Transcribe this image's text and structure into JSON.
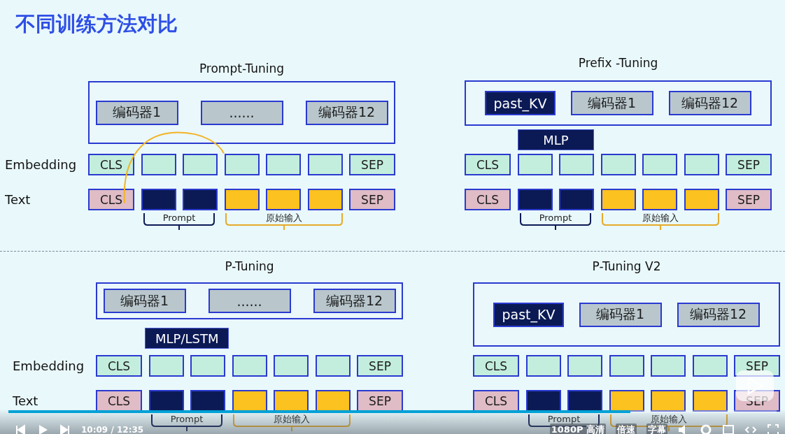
{
  "title": "不同训练方法对比",
  "panels": [
    {
      "title": "Prompt-Tuning",
      "encoders": [
        {
          "label": "编码器1",
          "kind": "layer"
        },
        {
          "label": "......",
          "kind": "layer"
        },
        {
          "label": "编码器12",
          "kind": "layer"
        }
      ],
      "link_curve": true,
      "rows": [
        {
          "label": "Embedding",
          "tokens": [
            {
              "label": "CLS",
              "kind": "embed"
            },
            {
              "kind": "embed"
            },
            {
              "kind": "embed"
            },
            {
              "kind": "embed"
            },
            {
              "kind": "embed"
            },
            {
              "kind": "embed"
            },
            {
              "label": "SEP",
              "kind": "embed"
            }
          ]
        },
        {
          "label": "Text",
          "tokens": [
            {
              "label": "CLS",
              "kind": "special"
            },
            {
              "kind": "prompt"
            },
            {
              "kind": "prompt"
            },
            {
              "kind": "input"
            },
            {
              "kind": "input"
            },
            {
              "kind": "input"
            },
            {
              "label": "SEP",
              "kind": "special"
            }
          ]
        }
      ],
      "braces": [
        {
          "label": "Prompt",
          "kind": "prompt"
        },
        {
          "label": "原始输入",
          "kind": "input"
        }
      ]
    },
    {
      "title": "Prefix -Tuning",
      "encoders": [
        {
          "label": "past_KV",
          "kind": "prefix"
        },
        {
          "label": "编码器1",
          "kind": "layer"
        },
        {
          "label": "编码器12",
          "kind": "layer"
        }
      ],
      "mlp": "MLP",
      "rows": [
        {
          "tokens": [
            {
              "label": "CLS",
              "kind": "embed"
            },
            {
              "kind": "embed"
            },
            {
              "kind": "embed"
            },
            {
              "kind": "embed"
            },
            {
              "kind": "embed"
            },
            {
              "kind": "embed"
            },
            {
              "label": "SEP",
              "kind": "embed"
            }
          ]
        },
        {
          "tokens": [
            {
              "label": "CLS",
              "kind": "special"
            },
            {
              "kind": "prompt"
            },
            {
              "kind": "prompt"
            },
            {
              "kind": "input"
            },
            {
              "kind": "input"
            },
            {
              "kind": "input"
            },
            {
              "label": "SEP",
              "kind": "special"
            }
          ]
        }
      ],
      "braces": [
        {
          "label": "Prompt",
          "kind": "prompt"
        },
        {
          "label": "原始输入",
          "kind": "input"
        }
      ]
    },
    {
      "title": "P-Tuning",
      "encoders": [
        {
          "label": "编码器1",
          "kind": "layer"
        },
        {
          "label": "......",
          "kind": "layer"
        },
        {
          "label": "编码器12",
          "kind": "layer"
        }
      ],
      "mlp": "MLP/LSTM",
      "rows": [
        {
          "label": "Embedding",
          "tokens": [
            {
              "label": "CLS",
              "kind": "embed"
            },
            {
              "kind": "embed"
            },
            {
              "kind": "embed"
            },
            {
              "kind": "embed"
            },
            {
              "kind": "embed"
            },
            {
              "kind": "embed"
            },
            {
              "label": "SEP",
              "kind": "embed"
            }
          ]
        },
        {
          "label": "Text",
          "tokens": [
            {
              "label": "CLS",
              "kind": "special"
            },
            {
              "kind": "prompt"
            },
            {
              "kind": "prompt"
            },
            {
              "kind": "input"
            },
            {
              "kind": "input"
            },
            {
              "kind": "input"
            },
            {
              "label": "SEP",
              "kind": "special"
            }
          ]
        }
      ],
      "braces": [
        {
          "label": "Prompt",
          "kind": "prompt"
        },
        {
          "label": "原始输入",
          "kind": "input"
        }
      ]
    },
    {
      "title": "P-Tuning V2",
      "encoders": [
        {
          "label": "past_KV",
          "kind": "prefix"
        },
        {
          "label": "编码器1",
          "kind": "layer"
        },
        {
          "label": "编码器12",
          "kind": "layer"
        }
      ],
      "rows": [
        {
          "tokens": [
            {
              "label": "CLS",
              "kind": "embed"
            },
            {
              "kind": "embed"
            },
            {
              "kind": "embed"
            },
            {
              "kind": "embed"
            },
            {
              "kind": "embed"
            },
            {
              "kind": "embed"
            },
            {
              "label": "SEP",
              "kind": "embed"
            }
          ]
        },
        {
          "tokens": [
            {
              "label": "CLS",
              "kind": "special"
            },
            {
              "kind": "prompt"
            },
            {
              "kind": "prompt"
            },
            {
              "kind": "input"
            },
            {
              "kind": "input"
            },
            {
              "kind": "input"
            },
            {
              "label": "SEP",
              "kind": "special"
            }
          ]
        }
      ],
      "braces": [
        {
          "label": "Prompt",
          "kind": "prompt"
        },
        {
          "label": "原始输入",
          "kind": "input"
        }
      ]
    }
  ],
  "player": {
    "progress": {
      "level": 0.81
    },
    "time": "10:09 / 12:35",
    "quality": "1080P 高清",
    "speed": "倍速",
    "subtitles": "字幕"
  }
}
